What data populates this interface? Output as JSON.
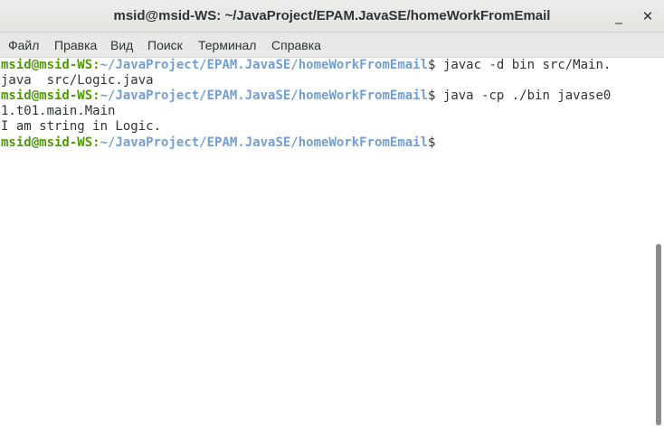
{
  "window": {
    "title": "msid@msid-WS: ~/JavaProject/EPAM.JavaSE/homeWorkFromEmail",
    "minimize_glyph": "_",
    "close_glyph": "✕"
  },
  "menu": {
    "items": [
      "Файл",
      "Правка",
      "Вид",
      "Поиск",
      "Терминал",
      "Справка"
    ]
  },
  "terminal": {
    "user_host": "msid@msid-WS",
    "separator": ":",
    "path": "~/JavaProject/EPAM.JavaSE/homeWorkFromEmail",
    "prompt_symbol": "$",
    "lines": [
      {
        "prompt": true,
        "text": " javac -d bin src/Main."
      },
      {
        "prompt": false,
        "text": "java  src/Logic.java"
      },
      {
        "prompt": true,
        "text": " java -cp ./bin javase0"
      },
      {
        "prompt": false,
        "text": "1.t01.main.Main"
      },
      {
        "prompt": false,
        "text": "I am string in Logic."
      },
      {
        "prompt": true,
        "text": ""
      }
    ]
  },
  "scrollbar": {
    "position_fraction": 0.5,
    "visible_fraction": 0.49
  },
  "colors": {
    "prompt_user": "#4e9a06",
    "prompt_path": "#729fcf",
    "text": "#2e3436",
    "background": "#ffffff"
  }
}
